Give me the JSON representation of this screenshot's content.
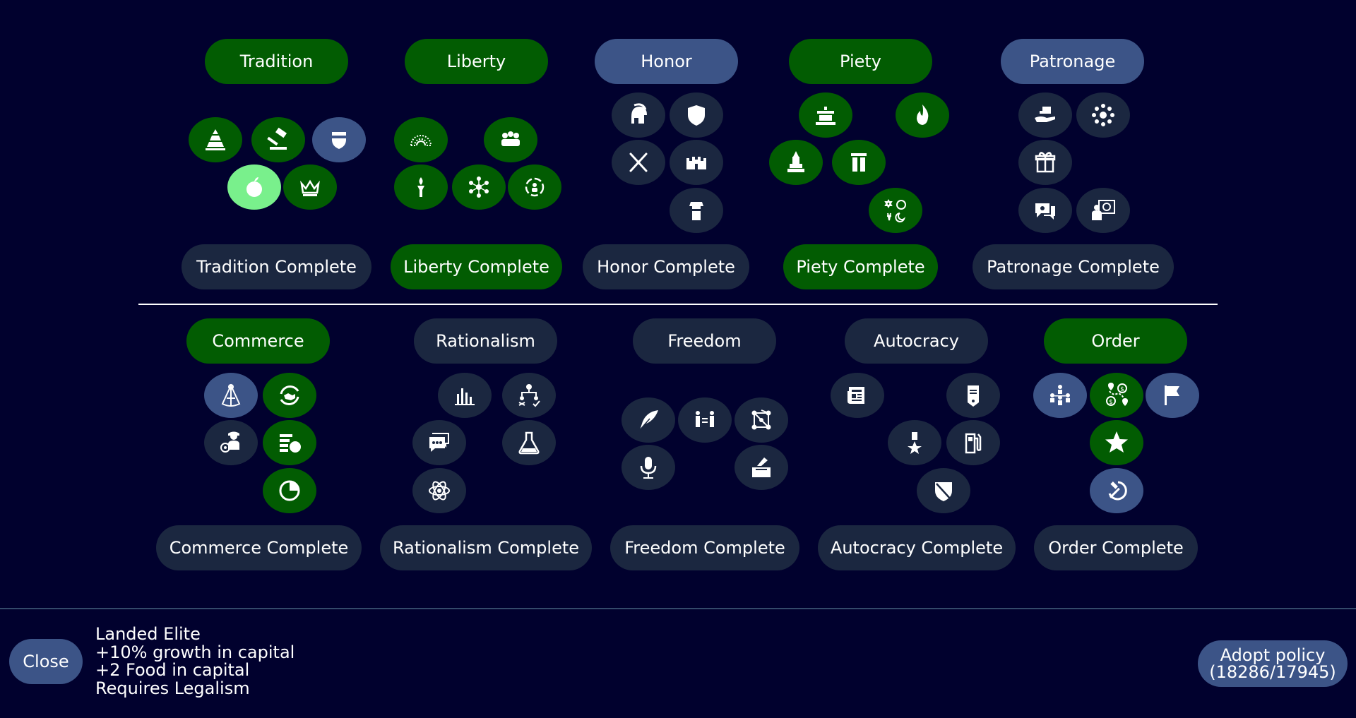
{
  "branches": {
    "tradition": "Tradition",
    "liberty": "Liberty",
    "honor": "Honor",
    "piety": "Piety",
    "patronage": "Patronage",
    "commerce": "Commerce",
    "rationalism": "Rationalism",
    "freedom": "Freedom",
    "autocracy": "Autocracy",
    "order": "Order"
  },
  "completes": {
    "tradition": "Tradition Complete",
    "liberty": "Liberty Complete",
    "honor": "Honor Complete",
    "piety": "Piety Complete",
    "patronage": "Patronage Complete",
    "commerce": "Commerce Complete",
    "rationalism": "Rationalism Complete",
    "freedom": "Freedom Complete",
    "autocracy": "Autocracy Complete",
    "order": "Order Complete"
  },
  "colors": {
    "background": "#01012e",
    "adopted": "#025c02",
    "available": "#3c5487",
    "locked": "#1b2740",
    "selected": "#79f08c"
  },
  "selected_policy": {
    "name": "Landed Elite",
    "effects": [
      "+10% growth in capital",
      "+2 Food in capital"
    ],
    "requirement": "Requires Legalism"
  },
  "buttons": {
    "close": "Close",
    "adopt_label": "Adopt policy",
    "adopt_cost": "(18286/17945)"
  }
}
